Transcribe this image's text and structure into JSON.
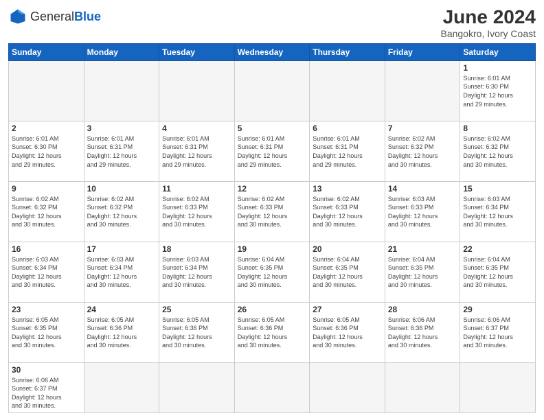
{
  "header": {
    "logo_general": "General",
    "logo_blue": "Blue",
    "title": "June 2024",
    "subtitle": "Bangokro, Ivory Coast"
  },
  "weekdays": [
    "Sunday",
    "Monday",
    "Tuesday",
    "Wednesday",
    "Thursday",
    "Friday",
    "Saturday"
  ],
  "weeks": [
    [
      {
        "day": "",
        "info": "",
        "empty": true
      },
      {
        "day": "",
        "info": "",
        "empty": true
      },
      {
        "day": "",
        "info": "",
        "empty": true
      },
      {
        "day": "",
        "info": "",
        "empty": true
      },
      {
        "day": "",
        "info": "",
        "empty": true
      },
      {
        "day": "",
        "info": "",
        "empty": true
      },
      {
        "day": "1",
        "info": "Sunrise: 6:01 AM\nSunset: 6:30 PM\nDaylight: 12 hours\nand 29 minutes.",
        "empty": false
      }
    ],
    [
      {
        "day": "2",
        "info": "Sunrise: 6:01 AM\nSunset: 6:30 PM\nDaylight: 12 hours\nand 29 minutes.",
        "empty": false
      },
      {
        "day": "3",
        "info": "Sunrise: 6:01 AM\nSunset: 6:31 PM\nDaylight: 12 hours\nand 29 minutes.",
        "empty": false
      },
      {
        "day": "4",
        "info": "Sunrise: 6:01 AM\nSunset: 6:31 PM\nDaylight: 12 hours\nand 29 minutes.",
        "empty": false
      },
      {
        "day": "5",
        "info": "Sunrise: 6:01 AM\nSunset: 6:31 PM\nDaylight: 12 hours\nand 29 minutes.",
        "empty": false
      },
      {
        "day": "6",
        "info": "Sunrise: 6:01 AM\nSunset: 6:31 PM\nDaylight: 12 hours\nand 29 minutes.",
        "empty": false
      },
      {
        "day": "7",
        "info": "Sunrise: 6:02 AM\nSunset: 6:32 PM\nDaylight: 12 hours\nand 30 minutes.",
        "empty": false
      },
      {
        "day": "8",
        "info": "Sunrise: 6:02 AM\nSunset: 6:32 PM\nDaylight: 12 hours\nand 30 minutes.",
        "empty": false
      }
    ],
    [
      {
        "day": "9",
        "info": "Sunrise: 6:02 AM\nSunset: 6:32 PM\nDaylight: 12 hours\nand 30 minutes.",
        "empty": false
      },
      {
        "day": "10",
        "info": "Sunrise: 6:02 AM\nSunset: 6:32 PM\nDaylight: 12 hours\nand 30 minutes.",
        "empty": false
      },
      {
        "day": "11",
        "info": "Sunrise: 6:02 AM\nSunset: 6:33 PM\nDaylight: 12 hours\nand 30 minutes.",
        "empty": false
      },
      {
        "day": "12",
        "info": "Sunrise: 6:02 AM\nSunset: 6:33 PM\nDaylight: 12 hours\nand 30 minutes.",
        "empty": false
      },
      {
        "day": "13",
        "info": "Sunrise: 6:02 AM\nSunset: 6:33 PM\nDaylight: 12 hours\nand 30 minutes.",
        "empty": false
      },
      {
        "day": "14",
        "info": "Sunrise: 6:03 AM\nSunset: 6:33 PM\nDaylight: 12 hours\nand 30 minutes.",
        "empty": false
      },
      {
        "day": "15",
        "info": "Sunrise: 6:03 AM\nSunset: 6:34 PM\nDaylight: 12 hours\nand 30 minutes.",
        "empty": false
      }
    ],
    [
      {
        "day": "16",
        "info": "Sunrise: 6:03 AM\nSunset: 6:34 PM\nDaylight: 12 hours\nand 30 minutes.",
        "empty": false
      },
      {
        "day": "17",
        "info": "Sunrise: 6:03 AM\nSunset: 6:34 PM\nDaylight: 12 hours\nand 30 minutes.",
        "empty": false
      },
      {
        "day": "18",
        "info": "Sunrise: 6:03 AM\nSunset: 6:34 PM\nDaylight: 12 hours\nand 30 minutes.",
        "empty": false
      },
      {
        "day": "19",
        "info": "Sunrise: 6:04 AM\nSunset: 6:35 PM\nDaylight: 12 hours\nand 30 minutes.",
        "empty": false
      },
      {
        "day": "20",
        "info": "Sunrise: 6:04 AM\nSunset: 6:35 PM\nDaylight: 12 hours\nand 30 minutes.",
        "empty": false
      },
      {
        "day": "21",
        "info": "Sunrise: 6:04 AM\nSunset: 6:35 PM\nDaylight: 12 hours\nand 30 minutes.",
        "empty": false
      },
      {
        "day": "22",
        "info": "Sunrise: 6:04 AM\nSunset: 6:35 PM\nDaylight: 12 hours\nand 30 minutes.",
        "empty": false
      }
    ],
    [
      {
        "day": "23",
        "info": "Sunrise: 6:05 AM\nSunset: 6:35 PM\nDaylight: 12 hours\nand 30 minutes.",
        "empty": false
      },
      {
        "day": "24",
        "info": "Sunrise: 6:05 AM\nSunset: 6:36 PM\nDaylight: 12 hours\nand 30 minutes.",
        "empty": false
      },
      {
        "day": "25",
        "info": "Sunrise: 6:05 AM\nSunset: 6:36 PM\nDaylight: 12 hours\nand 30 minutes.",
        "empty": false
      },
      {
        "day": "26",
        "info": "Sunrise: 6:05 AM\nSunset: 6:36 PM\nDaylight: 12 hours\nand 30 minutes.",
        "empty": false
      },
      {
        "day": "27",
        "info": "Sunrise: 6:05 AM\nSunset: 6:36 PM\nDaylight: 12 hours\nand 30 minutes.",
        "empty": false
      },
      {
        "day": "28",
        "info": "Sunrise: 6:06 AM\nSunset: 6:36 PM\nDaylight: 12 hours\nand 30 minutes.",
        "empty": false
      },
      {
        "day": "29",
        "info": "Sunrise: 6:06 AM\nSunset: 6:37 PM\nDaylight: 12 hours\nand 30 minutes.",
        "empty": false
      }
    ],
    [
      {
        "day": "30",
        "info": "Sunrise: 6:06 AM\nSunset: 6:37 PM\nDaylight: 12 hours\nand 30 minutes.",
        "empty": false
      },
      {
        "day": "",
        "info": "",
        "empty": true
      },
      {
        "day": "",
        "info": "",
        "empty": true
      },
      {
        "day": "",
        "info": "",
        "empty": true
      },
      {
        "day": "",
        "info": "",
        "empty": true
      },
      {
        "day": "",
        "info": "",
        "empty": true
      },
      {
        "day": "",
        "info": "",
        "empty": true
      }
    ]
  ]
}
